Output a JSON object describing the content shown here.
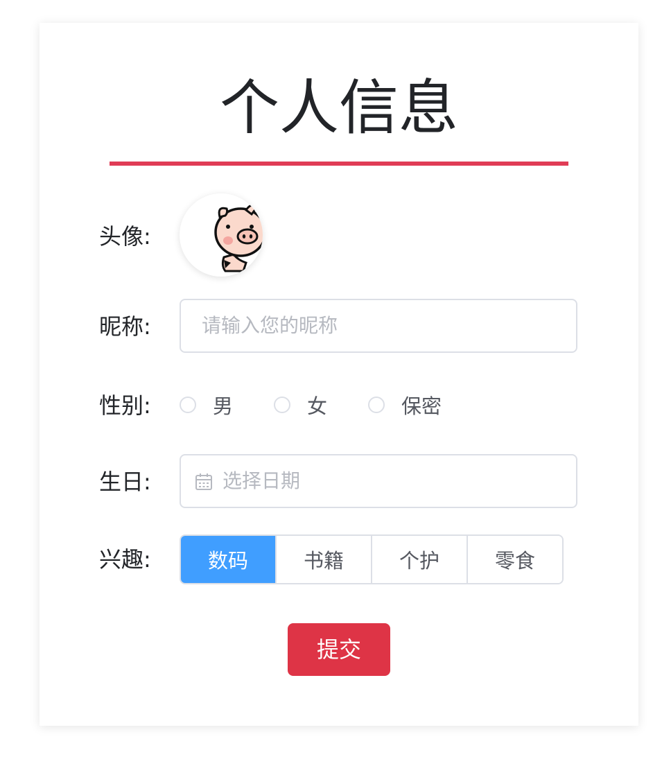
{
  "page": {
    "title": "个人信息"
  },
  "form": {
    "avatar_label": "头像:",
    "nickname_label": "昵称:",
    "nickname_placeholder": "请输入您的昵称",
    "nickname_value": "",
    "gender_label": "性别:",
    "gender_options": [
      "男",
      "女",
      "保密"
    ],
    "birthday_label": "生日:",
    "birthday_placeholder": "选择日期",
    "birthday_icon": "calendar-icon",
    "hobby_label": "兴趣:",
    "hobby_options": [
      "数码",
      "书籍",
      "个护",
      "零食"
    ],
    "hobby_selected": "数码",
    "submit_label": "提交"
  },
  "colors": {
    "accent_red": "#e03c56",
    "submit_red": "#de3446",
    "selected_blue": "#409eff",
    "border_gray": "#dcdfe6"
  }
}
